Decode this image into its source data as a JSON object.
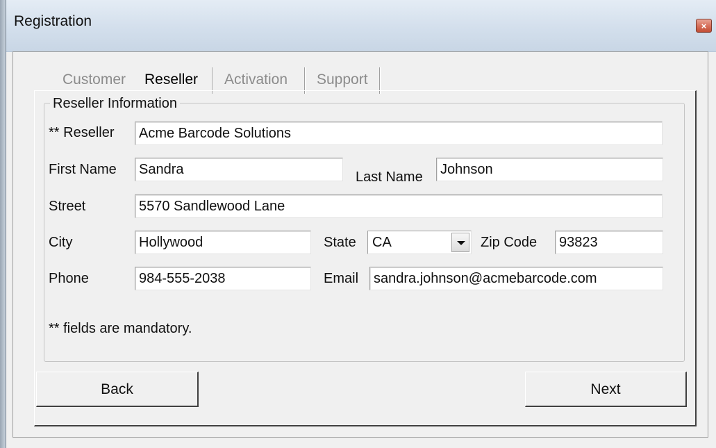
{
  "window": {
    "title": "Registration",
    "close_label": "×"
  },
  "tabs": [
    {
      "label": "Customer",
      "active": false
    },
    {
      "label": "Reseller",
      "active": true
    },
    {
      "label": "Activation",
      "active": false
    },
    {
      "label": "Support",
      "active": false
    }
  ],
  "group": {
    "title": "Reseller Information"
  },
  "fields": {
    "reseller": {
      "label": "** Reseller",
      "value": "Acme Barcode Solutions"
    },
    "first_name": {
      "label": "First Name",
      "value": "Sandra"
    },
    "last_name": {
      "label": "Last Name",
      "value": "Johnson"
    },
    "street": {
      "label": "Street",
      "value": "5570 Sandlewood Lane"
    },
    "city": {
      "label": "City",
      "value": "Hollywood"
    },
    "state": {
      "label": "State",
      "value": "CA"
    },
    "zip": {
      "label": "Zip Code",
      "value": "93823"
    },
    "phone": {
      "label": "Phone",
      "value": "984-555-2038"
    },
    "email": {
      "label": "Email",
      "value": "sandra.johnson@acmebarcode.com"
    }
  },
  "note": "** fields are mandatory.",
  "buttons": {
    "back": "Back",
    "next": "Next"
  },
  "colors": {
    "titlebar": "#d3dfec",
    "client_bg": "#f0f0f0",
    "close_button": "#c24d34"
  }
}
